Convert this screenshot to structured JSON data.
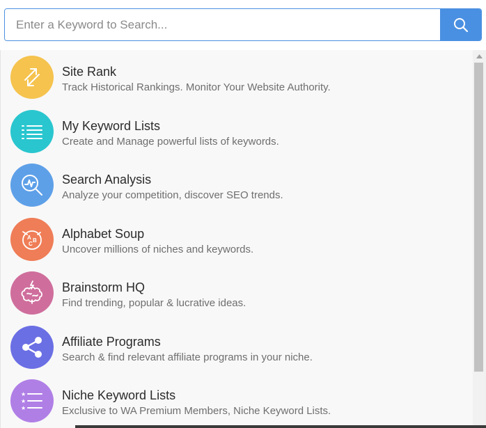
{
  "search": {
    "placeholder": "Enter a Keyword to Search..."
  },
  "colors": {
    "accent": "#4a90e2"
  },
  "items": [
    {
      "title": "Site Rank",
      "description": "Track Historical Rankings. Monitor Your Website Authority.",
      "icon": "transfer-arrows-icon",
      "color": "#f5c34e"
    },
    {
      "title": "My Keyword Lists",
      "description": "Create and Manage powerful lists of keywords.",
      "icon": "list-icon",
      "color": "#2ac6cf"
    },
    {
      "title": "Search Analysis",
      "description": "Analyze your competition, discover SEO trends.",
      "icon": "magnifier-chart-icon",
      "color": "#5ea0e8"
    },
    {
      "title": "Alphabet Soup",
      "description": "Uncover millions of niches and keywords.",
      "icon": "alphabet-bowl-icon",
      "color": "#ef7d57"
    },
    {
      "title": "Brainstorm HQ",
      "description": "Find trending, popular & lucrative ideas.",
      "icon": "brain-icon",
      "color": "#cf6e9c"
    },
    {
      "title": "Affiliate Programs",
      "description": "Search & find relevant affiliate programs in your niche.",
      "icon": "share-icon",
      "color": "#6b6fe4"
    },
    {
      "title": "Niche Keyword Lists",
      "description": "Exclusive to WA Premium Members, Niche Keyword Lists.",
      "icon": "star-list-icon",
      "color": "#b07fe6"
    }
  ]
}
